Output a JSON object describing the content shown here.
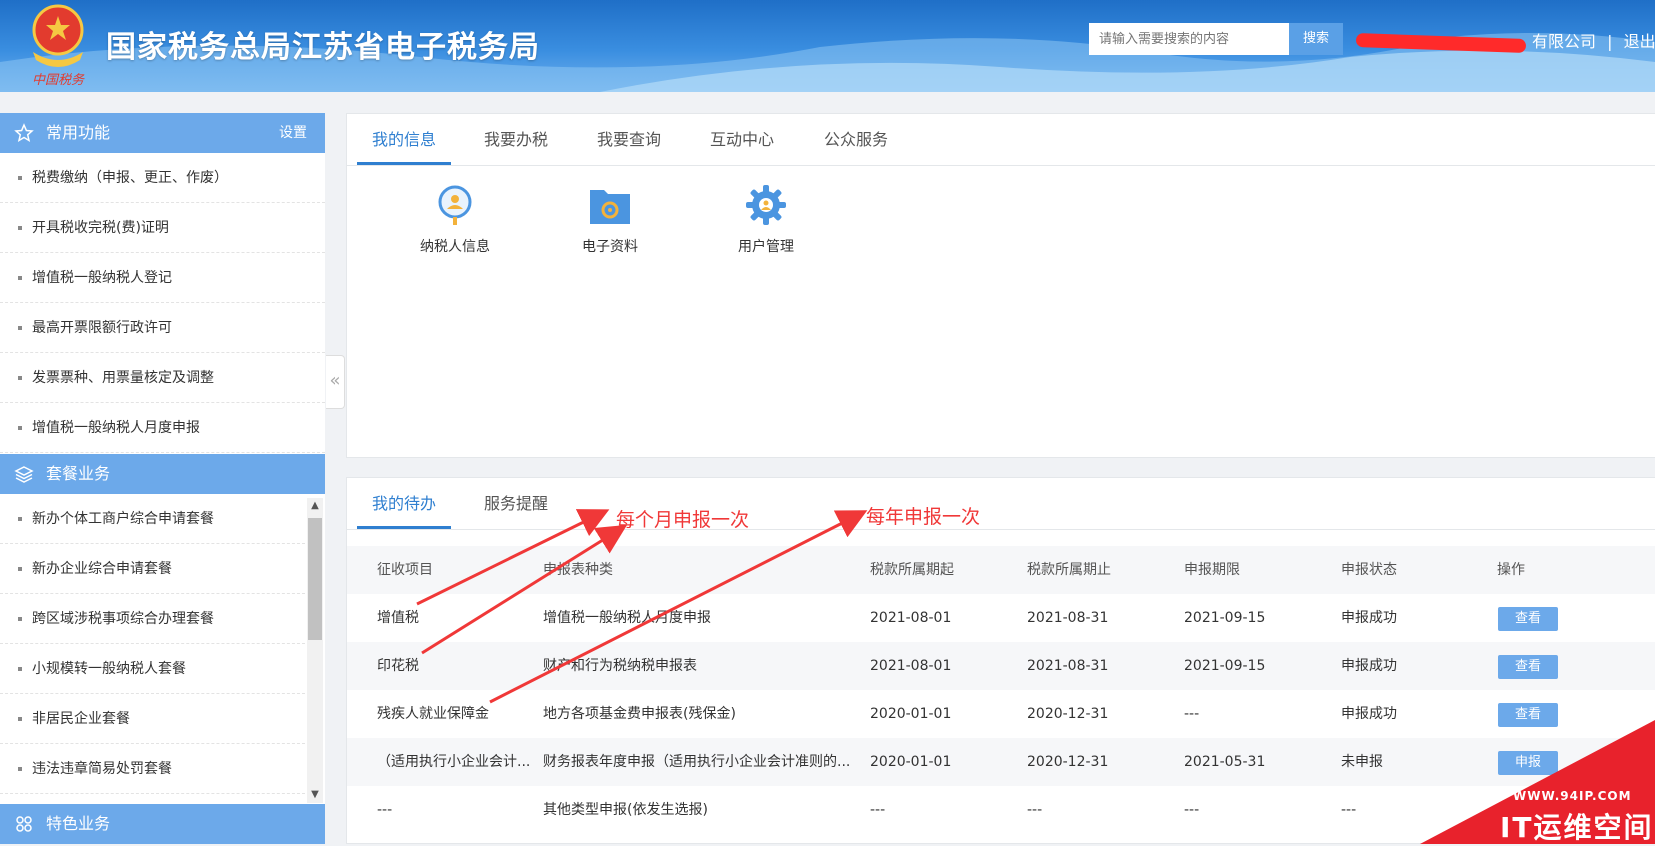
{
  "header": {
    "title": "国家税务总局江苏省电子税务局",
    "emblem_caption": "中国税务",
    "search_placeholder": "请输入需要搜索的内容",
    "search_button": "搜索",
    "company_suffix": "有限公司",
    "separator": "|",
    "logout": "退出"
  },
  "sidebar": {
    "common": {
      "title": "常用功能",
      "settings": "设置",
      "items": [
        "税费缴纳（申报、更正、作废）",
        "开具税收完税(费)证明",
        "增值税一般纳税人登记",
        "最高开票限额行政许可",
        "发票票种、用票量核定及调整",
        "增值税一般纳税人月度申报"
      ]
    },
    "package": {
      "title": "套餐业务",
      "items": [
        "新办个体工商户综合申请套餐",
        "新办企业综合申请套餐",
        "跨区域涉税事项综合办理套餐",
        "小规模转一般纳税人套餐",
        "非居民企业套餐",
        "违法违章简易处罚套餐"
      ]
    },
    "special": {
      "title": "特色业务"
    },
    "collapse_glyph": "«"
  },
  "main_tabs": [
    "我的信息",
    "我要办税",
    "我要查询",
    "互动中心",
    "公众服务"
  ],
  "apps": [
    {
      "label": "纳税人信息",
      "icon": "taxpayer-info-icon"
    },
    {
      "label": "电子资料",
      "icon": "electronic-docs-icon"
    },
    {
      "label": "用户管理",
      "icon": "gear-icon"
    }
  ],
  "todo": {
    "tabs": [
      "我的待办",
      "服务提醒"
    ],
    "columns": [
      "征收项目",
      "申报表种类",
      "税款所属期起",
      "税款所属期止",
      "申报期限",
      "申报状态",
      "操作"
    ],
    "rows": [
      [
        "增值税",
        "增值税一般纳税人月度申报",
        "2021-08-01",
        "2021-08-31",
        "2021-09-15",
        "申报成功",
        "查看"
      ],
      [
        "印花税",
        "财产和行为税纳税申报表",
        "2021-08-01",
        "2021-08-31",
        "2021-09-15",
        "申报成功",
        "查看"
      ],
      [
        "残疾人就业保障金",
        "地方各项基金费申报表(残保金)",
        "2020-01-01",
        "2020-12-31",
        "---",
        "申报成功",
        "查看"
      ],
      [
        "（适用执行小企业会计...",
        "财务报表年度申报（适用执行小企业会计准则的...",
        "2020-01-01",
        "2020-12-31",
        "2021-05-31",
        "未申报",
        "申报"
      ],
      [
        "---",
        "其他类型申报(依发生选报)",
        "---",
        "---",
        "---",
        "---",
        ""
      ]
    ]
  },
  "annotations": {
    "monthly": "每个月申报一次",
    "yearly": "每年申报一次"
  },
  "watermark": {
    "url": "WWW.94IP.COM",
    "name": "IT运维空间"
  },
  "colors": {
    "primary": "#2f7fd0",
    "sidebar_head": "#6ca9ea",
    "annotation": "#f03838"
  }
}
